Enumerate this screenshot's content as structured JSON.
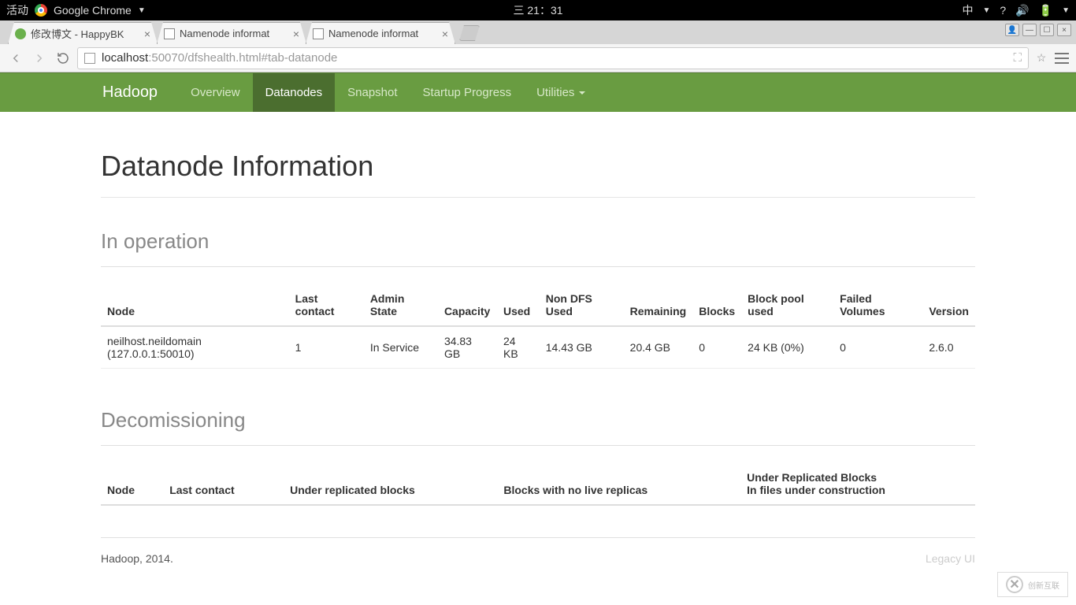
{
  "os": {
    "activities": "活动",
    "app_name": "Google Chrome",
    "clock": "三 21：31",
    "ime": "中"
  },
  "tabs": [
    {
      "title": "修改博文 - HappyBK",
      "favicon": "green"
    },
    {
      "title": "Namenode informat",
      "favicon": "doc"
    },
    {
      "title": "Namenode informat",
      "favicon": "doc"
    }
  ],
  "url": {
    "host": "localhost",
    "rest": ":50070/dfshealth.html#tab-datanode"
  },
  "nav": {
    "brand": "Hadoop",
    "items": [
      {
        "label": "Overview",
        "active": false
      },
      {
        "label": "Datanodes",
        "active": true
      },
      {
        "label": "Snapshot",
        "active": false
      },
      {
        "label": "Startup Progress",
        "active": false
      },
      {
        "label": "Utilities",
        "active": false,
        "dropdown": true
      }
    ]
  },
  "page": {
    "title": "Datanode Information",
    "section1": "In operation",
    "section2": "Decomissioning",
    "table1": {
      "headers": [
        "Node",
        "Last contact",
        "Admin State",
        "Capacity",
        "Used",
        "Non DFS Used",
        "Remaining",
        "Blocks",
        "Block pool used",
        "Failed Volumes",
        "Version"
      ],
      "rows": [
        [
          "neilhost.neildomain (127.0.0.1:50010)",
          "1",
          "In Service",
          "34.83 GB",
          "24 KB",
          "14.43 GB",
          "20.4 GB",
          "0",
          "24 KB (0%)",
          "0",
          "2.6.0"
        ]
      ]
    },
    "table2": {
      "headers": [
        "Node",
        "Last contact",
        "Under replicated blocks",
        "Blocks with no live replicas",
        "Under Replicated Blocks\nIn files under construction"
      ],
      "rows": []
    },
    "footer_left": "Hadoop, 2014.",
    "footer_right": "Legacy UI"
  },
  "watermark": {
    "brand": "创新互联",
    "sub": ""
  }
}
